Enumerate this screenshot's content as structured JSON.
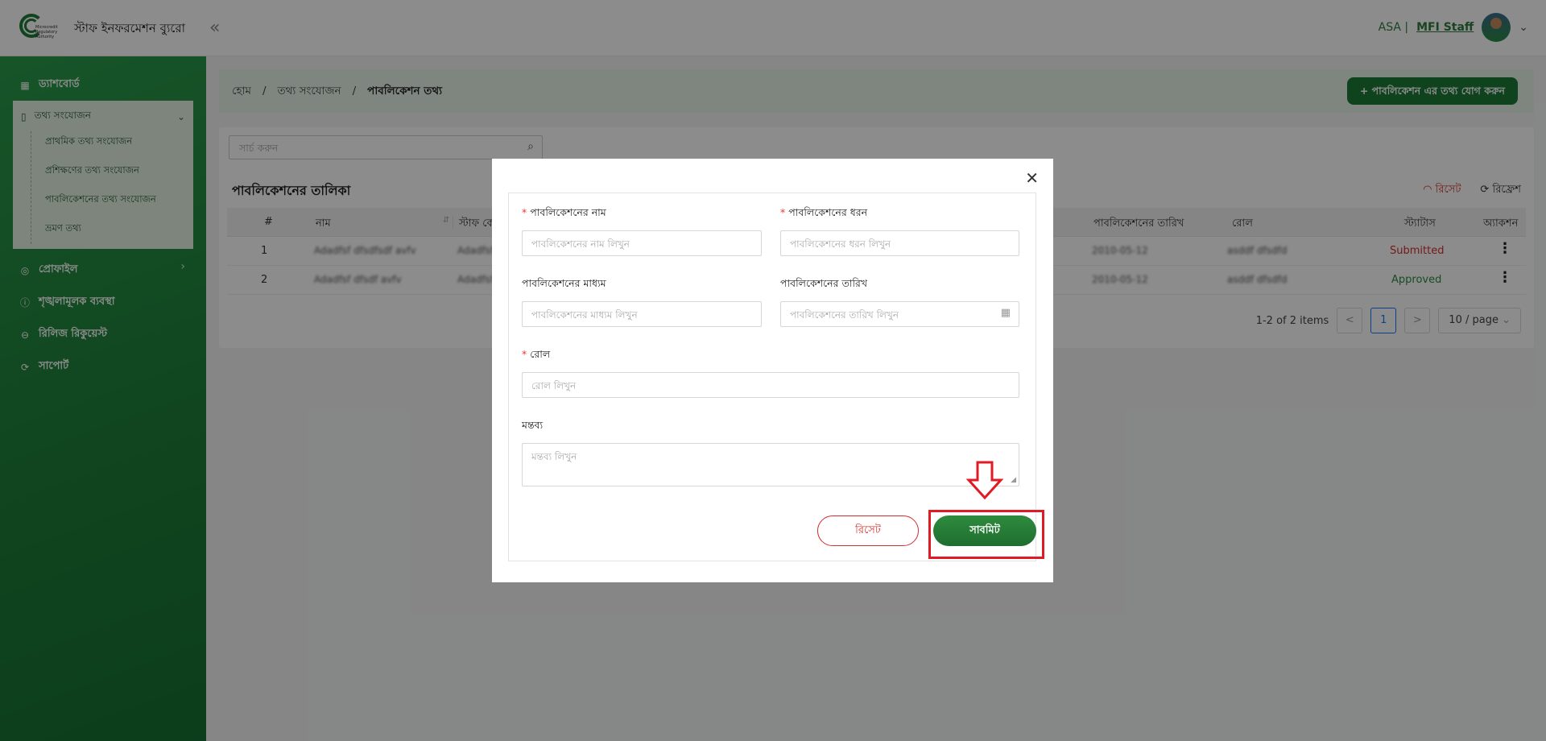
{
  "header": {
    "logo_lines": [
      "Microcredit",
      "Regulatory",
      "Authority"
    ],
    "brand": "স্টাফ ইনফরমেশন ব্যুরো",
    "collapse_icon": "double-chevron-left-icon",
    "org": "ASA |",
    "role": "MFI Staff"
  },
  "sidebar": {
    "dashboard": "ড্যাশবোর্ড",
    "data_collection": "তথ্য সংযোজন",
    "sub_items": [
      "প্রাথমিক তথ্য সংযোজন",
      "প্রশিক্ষণের তথ্য সংযোজন",
      "পাবলিকেশনের তথ্য সংযোজন",
      "ভ্রমণ তথ্য"
    ],
    "profile": "প্রোফাইল",
    "disciplinary": "শৃঙ্খলামূলক ব্যবস্থা",
    "release": "রিলিজ রিকুয়েস্ট",
    "support": "সাপোর্ট"
  },
  "breadcrumb": {
    "home": "হোম",
    "sep": "/",
    "section": "তথ্য সংযোজন",
    "current": "পাবলিকেশন তথ্য",
    "add_button": "+ পাবলিকেশন এর তথ্য যোগ করুন"
  },
  "list": {
    "search_placeholder": "সার্চ করুন",
    "title": "পাবলিকেশনের তালিকা",
    "reset": "রিসেট",
    "refresh": "রিফ্রেশ",
    "columns": {
      "num": "#",
      "name": "নাম",
      "staff_code": "স্টাফ কো",
      "pub_date": "পাবলিকেশনের তারিখ",
      "role": "রোল",
      "status": "স্ট্যাটাস",
      "action": "অ্যাকশন"
    },
    "rows": [
      {
        "num": "1",
        "name": "Adadfsf dfsdfsdf avfv",
        "staff": "Adadfsf",
        "date": "2010-05-12",
        "role": "asddf dfsdfd",
        "status": "Submitted"
      },
      {
        "num": "2",
        "name": "Adadfsf dfsdf avfv",
        "staff": "Adadfsf",
        "date": "2010-05-12",
        "role": "asddf dfsdfd",
        "status": "Approved"
      }
    ],
    "pagination": {
      "summary": "1-2 of 2 items",
      "prev": "<",
      "page": "1",
      "next": ">",
      "page_size": "10 / page"
    }
  },
  "modal": {
    "close": "✕",
    "fields": {
      "pub_name": {
        "label": "পাবলিকেশনের নাম",
        "placeholder": "পাবলিকেশনের নাম লিখুন",
        "required": "*"
      },
      "pub_type": {
        "label": "পাবলিকেশনের ধরন",
        "placeholder": "পাবলিকেশনের ধরন লিখুন",
        "required": "*"
      },
      "pub_medium": {
        "label": "পাবলিকেশনের মাধ্যম",
        "placeholder": "পাবলিকেশনের মাধ্যম লিখুন"
      },
      "pub_date": {
        "label": "পাবলিকেশনের তারিখ",
        "placeholder": "পাবলিকেশনের তারিখ লিখুন"
      },
      "role": {
        "label": "রোল",
        "placeholder": "রোল লিখুন",
        "required": "*"
      },
      "comment": {
        "label": "মন্তব্য",
        "placeholder": "মন্তব্য লিখুন"
      }
    },
    "reset_button": "রিসেট",
    "submit_button": "সাবমিট"
  },
  "colors": {
    "brand_green": "#1f7a35",
    "highlight_red": "#e01b24",
    "overlay": "rgba(0,0,0,0.45)"
  }
}
